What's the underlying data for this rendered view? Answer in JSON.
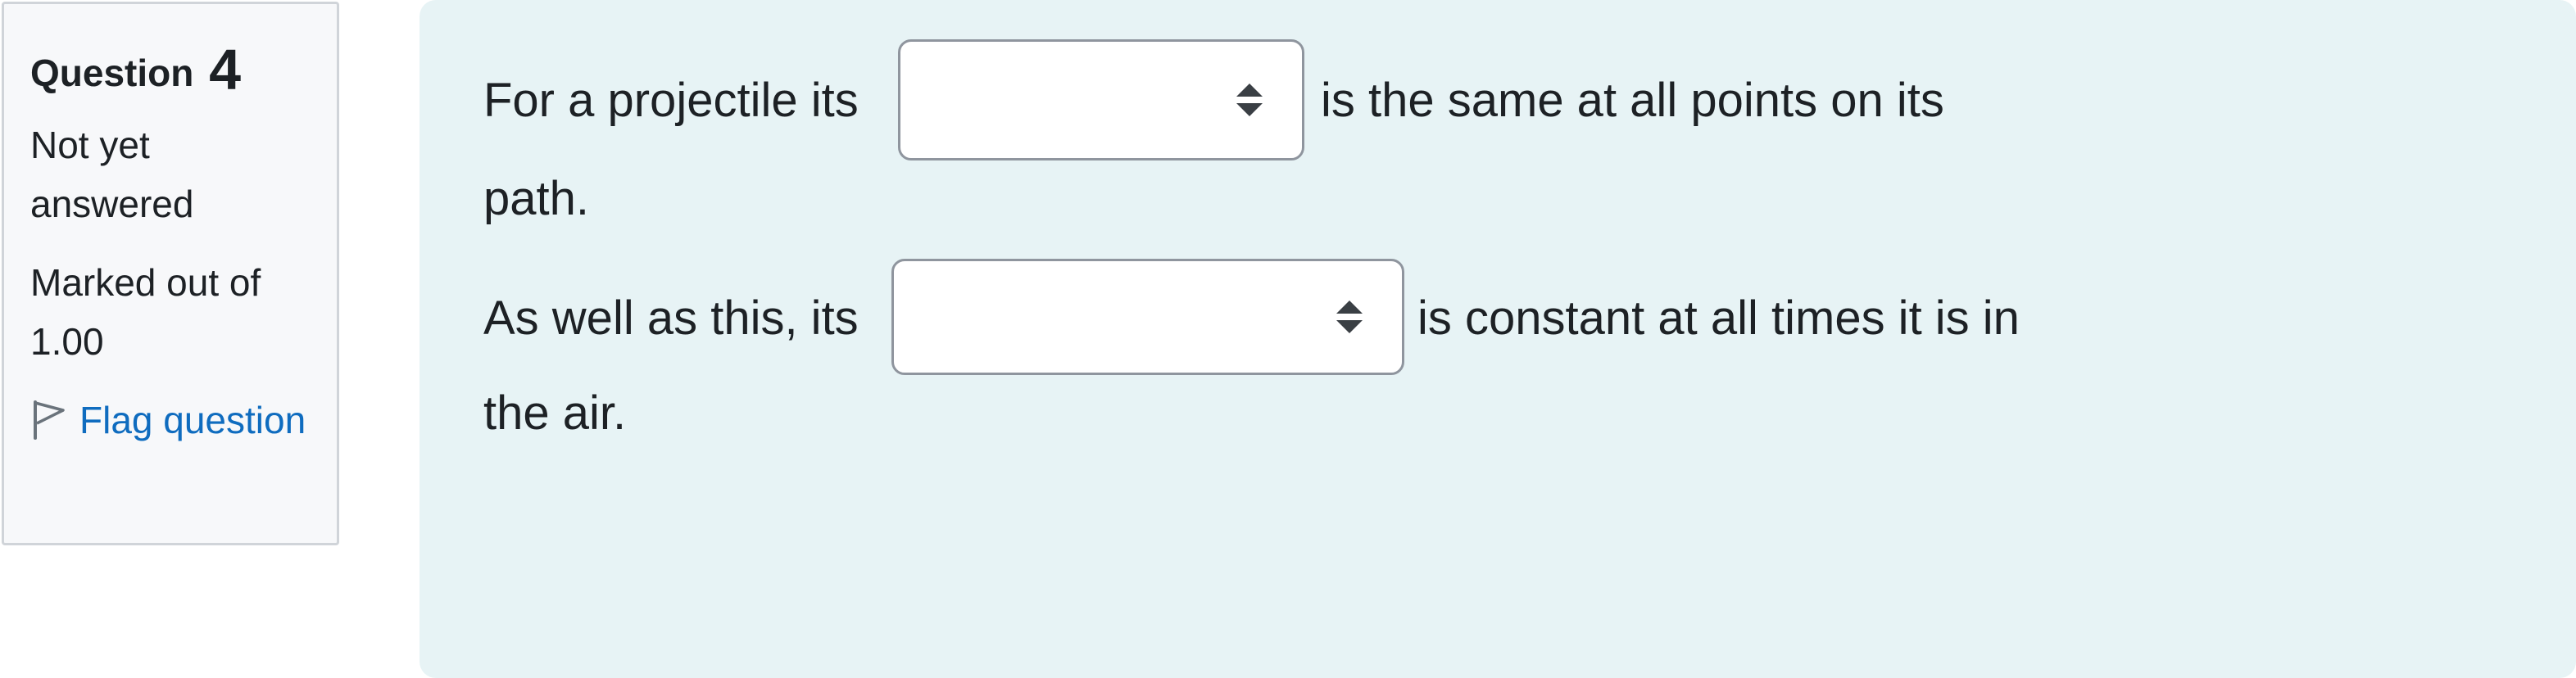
{
  "info": {
    "question_label": "Question",
    "question_number": "4",
    "status": "Not yet answered",
    "marks": "Marked out of 1.00",
    "flag_label": "Flag question"
  },
  "question": {
    "sentence1_part1": "For a projectile its",
    "sentence1_part2": "is the same at all points on its",
    "sentence1_part3": "path.",
    "sentence2_part1": "As well as this, its",
    "sentence2_part2": "is constant at all times it is in",
    "sentence2_part3": "the air.",
    "select1_value": "",
    "select2_value": ""
  },
  "colors": {
    "panel_bg": "#e7f3f5",
    "info_bg": "#f7f8fa",
    "link": "#0f6cbf"
  },
  "icons": {
    "flag": "flag-icon",
    "select_arrows": "sort-arrows-icon"
  }
}
